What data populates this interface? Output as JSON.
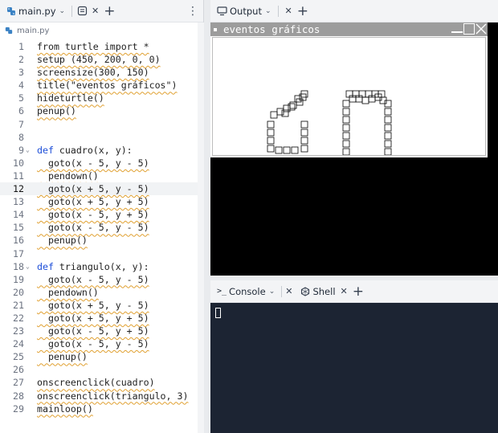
{
  "editor": {
    "tab_label": "main.py",
    "breadcrumb": "main.py",
    "current_line": 12,
    "lines": [
      {
        "n": "1",
        "text": "from turtle import *",
        "wavy": true
      },
      {
        "n": "2",
        "text": "setup (450, 200, 0, 0)",
        "wavy": true
      },
      {
        "n": "3",
        "text": "screensize(300, 150)",
        "wavy": true
      },
      {
        "n": "4",
        "text": "title(\"eventos gráficos\")",
        "wavy": true
      },
      {
        "n": "5",
        "text": "hideturtle()",
        "wavy": true
      },
      {
        "n": "6",
        "text": "penup()",
        "wavy": true
      },
      {
        "n": "7",
        "text": "",
        "wavy": false
      },
      {
        "n": "8",
        "text": "",
        "wavy": false
      },
      {
        "n": "9",
        "text": "def cuadro(x, y):",
        "wavy": false,
        "fold": true
      },
      {
        "n": "10",
        "text": "  goto(x - 5, y - 5)",
        "wavy": true
      },
      {
        "n": "11",
        "text": "  pendown()",
        "wavy": true
      },
      {
        "n": "12",
        "text": "  goto(x + 5, y - 5)",
        "wavy": true
      },
      {
        "n": "13",
        "text": "  goto(x + 5, y + 5)",
        "wavy": true
      },
      {
        "n": "14",
        "text": "  goto(x - 5, y + 5)",
        "wavy": true
      },
      {
        "n": "15",
        "text": "  goto(x - 5, y - 5)",
        "wavy": true
      },
      {
        "n": "16",
        "text": "  penup()",
        "wavy": true
      },
      {
        "n": "17",
        "text": "",
        "wavy": false
      },
      {
        "n": "18",
        "text": "def triangulo(x, y):",
        "wavy": false,
        "fold": true
      },
      {
        "n": "19",
        "text": "  goto(x - 5, y - 5)",
        "wavy": true
      },
      {
        "n": "20",
        "text": "  pendown()",
        "wavy": true
      },
      {
        "n": "21",
        "text": "  goto(x + 5, y - 5)",
        "wavy": true
      },
      {
        "n": "22",
        "text": "  goto(x + 5, y + 5)",
        "wavy": true
      },
      {
        "n": "23",
        "text": "  goto(x - 5, y + 5)",
        "wavy": true
      },
      {
        "n": "24",
        "text": "  goto(x - 5, y - 5)",
        "wavy": true
      },
      {
        "n": "25",
        "text": "  penup()",
        "wavy": true
      },
      {
        "n": "26",
        "text": "",
        "wavy": false
      },
      {
        "n": "27",
        "text": "onscreenclick(cuadro)",
        "wavy": true
      },
      {
        "n": "28",
        "text": "onscreenclick(triangulo, 3)",
        "wavy": true
      },
      {
        "n": "29",
        "text": "mainloop()",
        "wavy": true
      }
    ]
  },
  "output": {
    "tab_label": "Output",
    "window_title": "eventos gráficos"
  },
  "console": {
    "console_tab": "Console",
    "shell_tab": "Shell"
  },
  "colors": {
    "keyword": "#1d4ed8",
    "squiggle": "#e0a030",
    "console_bg": "#1c2433",
    "titlebar": "#9c9c9c"
  }
}
